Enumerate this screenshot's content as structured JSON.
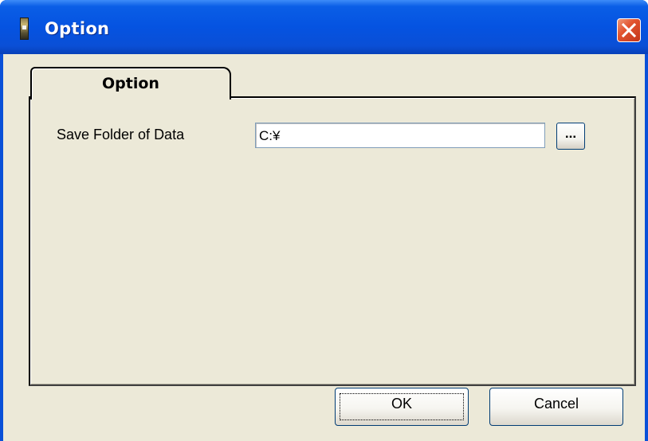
{
  "window": {
    "title": "Option"
  },
  "tabs": [
    {
      "label": "Option",
      "selected": true
    }
  ],
  "option_panel": {
    "save_folder_label": "Save Folder of Data",
    "save_folder_value": "C:¥",
    "browse_label": "..."
  },
  "buttons": {
    "ok_label": "OK",
    "cancel_label": "Cancel"
  },
  "colors": {
    "titlebar": "#0553e1",
    "close_button": "#e2542f",
    "dialog_background": "#ece9d8"
  }
}
